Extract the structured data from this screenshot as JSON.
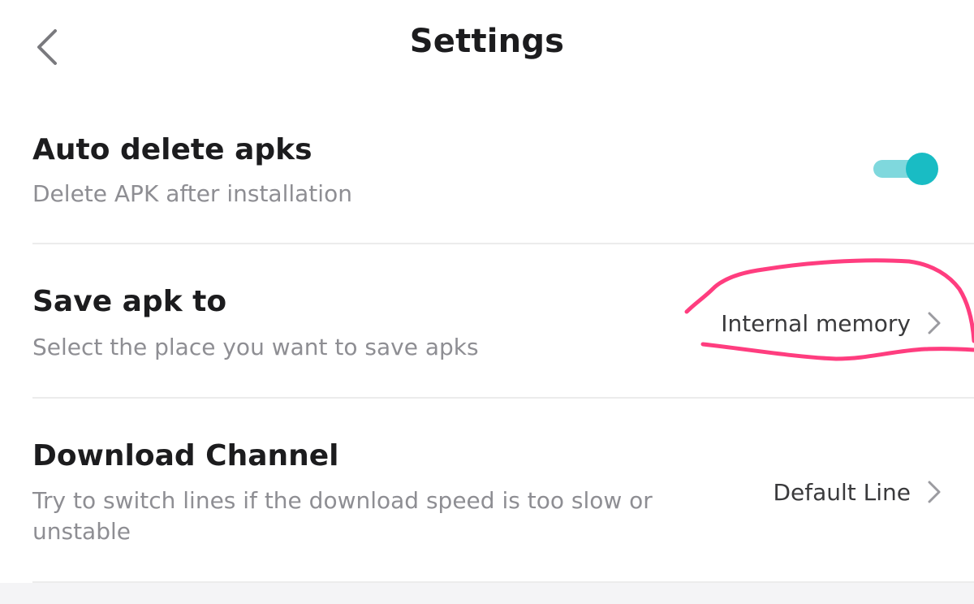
{
  "header": {
    "title": "Settings",
    "back_icon": "chevron-left-icon"
  },
  "settings": {
    "auto_delete": {
      "title": "Auto delete apks",
      "subtitle": "Delete APK after installation",
      "toggle_on": true,
      "toggle_track_color": "#7fd8dd",
      "toggle_knob_color": "#19bcc4"
    },
    "save_apk": {
      "title": "Save apk to",
      "subtitle": "Select the place you want to save apks",
      "value": "Internal memory",
      "icon": "chevron-right-icon"
    },
    "download_channel": {
      "title": "Download Channel",
      "subtitle": "Try to switch lines if the download speed is too slow or unstable",
      "value": "Default Line",
      "icon": "chevron-right-icon"
    }
  },
  "annotation": {
    "color": "#ff3d7f"
  }
}
